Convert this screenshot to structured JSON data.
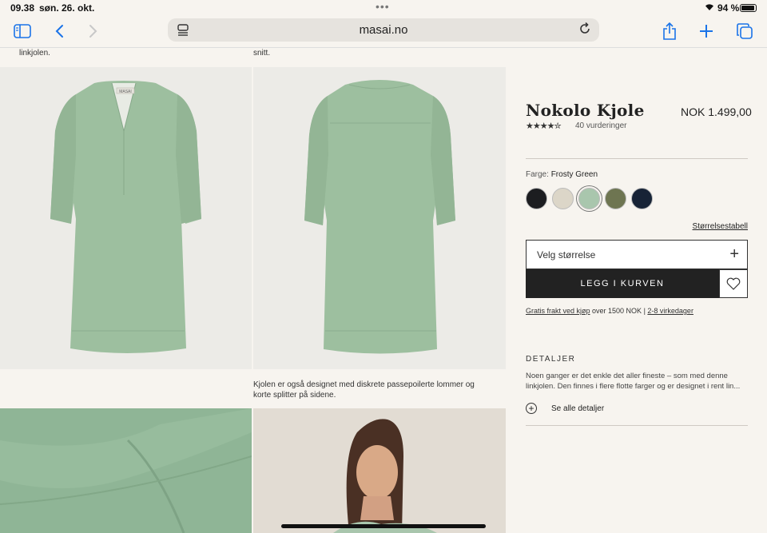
{
  "status": {
    "time": "09.38",
    "date": "søn. 26. okt.",
    "battery": "94 %"
  },
  "browser": {
    "url": "masai.no",
    "icons": [
      "sidebar-icon",
      "back-icon",
      "forward-icon",
      "reader-icon",
      "reload-icon",
      "share-icon",
      "new-tab-icon",
      "tabs-icon"
    ]
  },
  "gallery": {
    "caption_top_left": "linkjolen.",
    "caption_top_right": "snitt.",
    "caption_mid": "Kjolen er også designet med diskrete passepoilerte lommer og korte splitter på sidene.",
    "neck_label": "MASAI"
  },
  "product": {
    "title": "Nokolo Kjole",
    "price": "NOK 1.499,00",
    "rating": 4.5,
    "stars": "★★★★✮",
    "review_count": "40 vurderinger",
    "color_label": "Farge:",
    "color_value": "Frosty Green",
    "swatches": [
      {
        "name": "black",
        "color": "#1c1d20"
      },
      {
        "name": "natural",
        "color": "#dcd6c8"
      },
      {
        "name": "frosty-green",
        "color": "#a9c6ad",
        "selected": true
      },
      {
        "name": "olive",
        "color": "#6e7551"
      },
      {
        "name": "navy",
        "color": "#172336"
      }
    ],
    "size_guide": "Størrelsestabell",
    "size_placeholder": "Velg størrelse",
    "add_to_cart": "LEGG I KURVEN",
    "shipping_free": "Gratis frakt ved kjøp",
    "shipping_over": " over 1500 NOK | ",
    "shipping_days": "2-8 virkedager",
    "details_heading": "DETALJER",
    "details_text": "Noen ganger er det enkle det aller fineste – som med denne linkjolen. Den finnes i flere flotte farger og er designet i rent lin...",
    "see_all": "Se alle detaljer"
  },
  "colors": {
    "accent": "#1a73e8",
    "dress": "#9dbf9f",
    "button": "#222222"
  }
}
